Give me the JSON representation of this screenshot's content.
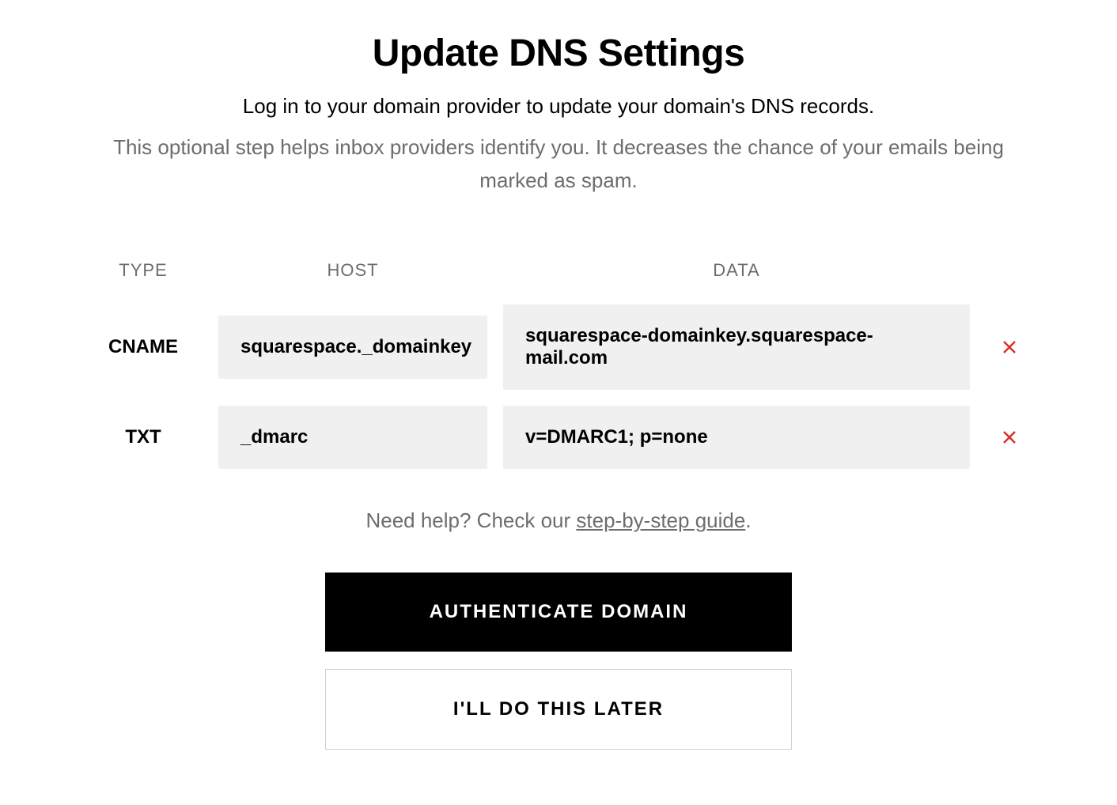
{
  "header": {
    "title": "Update DNS Settings",
    "subtitle": "Log in to your domain provider to update your domain's DNS records.",
    "description": "This optional step helps inbox providers identify you. It decreases the chance of your emails being marked as spam."
  },
  "table": {
    "headers": {
      "type": "TYPE",
      "host": "HOST",
      "data": "DATA"
    },
    "rows": [
      {
        "type": "CNAME",
        "host": "squarespace._domainkey",
        "data": "squarespace-domainkey.squarespace-mail.com",
        "status": "error"
      },
      {
        "type": "TXT",
        "host": "_dmarc",
        "data": "v=DMARC1; p=none",
        "status": "error"
      }
    ]
  },
  "help": {
    "prefix": "Need help? Check our ",
    "link_text": "step-by-step guide",
    "suffix": "."
  },
  "buttons": {
    "primary": "AUTHENTICATE DOMAIN",
    "secondary": "I'LL DO THIS LATER"
  }
}
